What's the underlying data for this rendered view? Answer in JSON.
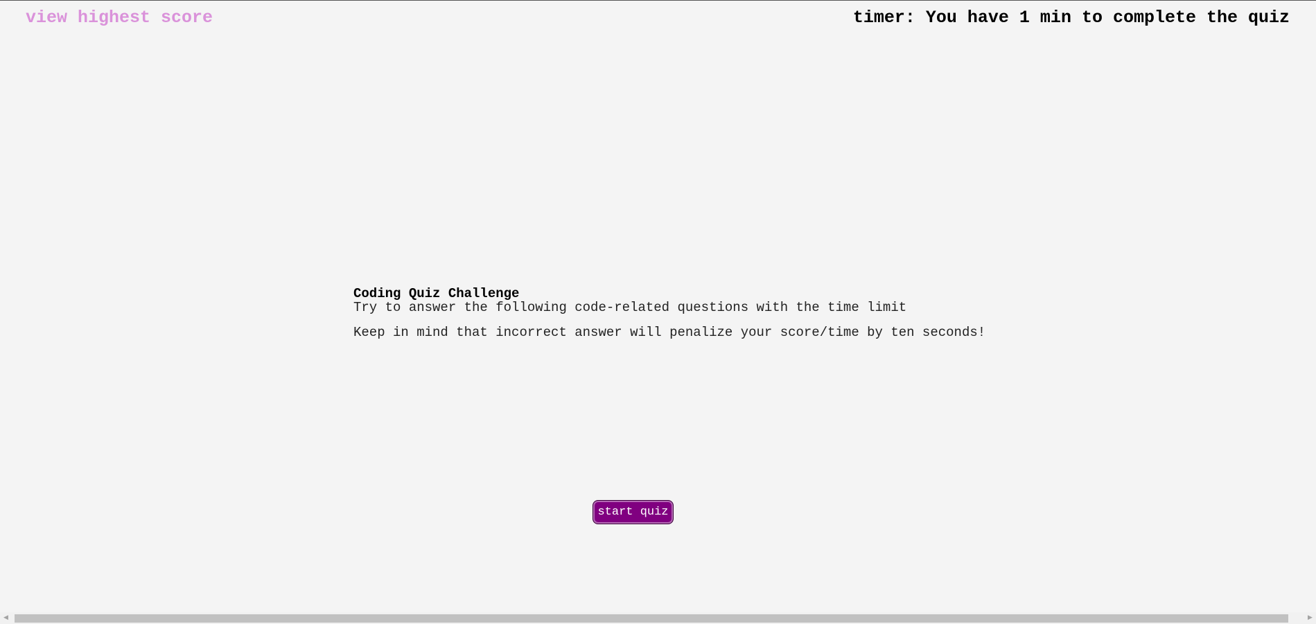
{
  "header": {
    "highscore_link": "view highest score",
    "timer_text": "timer: You have 1 min to complete the quiz"
  },
  "intro": {
    "title": "Coding Quiz Challenge",
    "line1": "Try to answer the following code-related questions with the time limit",
    "line2": "Keep in mind that incorrect answer will penalize your score/time by ten seconds!"
  },
  "start_button": {
    "label": "start quiz"
  },
  "scrollbar": {
    "left_arrow_icon": "◀",
    "right_arrow_icon": "▶"
  },
  "colors": {
    "link": "#da92da",
    "button": "#800080",
    "background": "#f4f4f4"
  }
}
